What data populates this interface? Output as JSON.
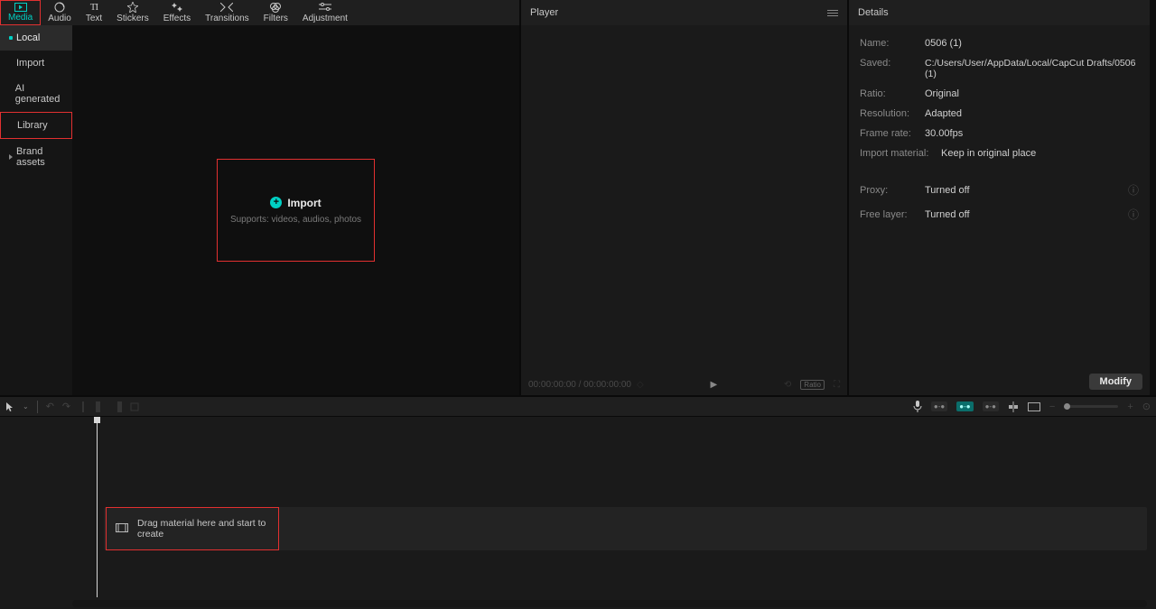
{
  "topTabs": [
    {
      "label": "Media",
      "icon": "media"
    },
    {
      "label": "Audio",
      "icon": "audio"
    },
    {
      "label": "Text",
      "icon": "text"
    },
    {
      "label": "Stickers",
      "icon": "stickers"
    },
    {
      "label": "Effects",
      "icon": "effects"
    },
    {
      "label": "Transitions",
      "icon": "transitions"
    },
    {
      "label": "Filters",
      "icon": "filters"
    },
    {
      "label": "Adjustment",
      "icon": "adjustment"
    }
  ],
  "sidebar": {
    "local": "Local",
    "import": "Import",
    "ai": "AI generated",
    "library": "Library",
    "brand": "Brand assets"
  },
  "importArea": {
    "label": "Import",
    "sub": "Supports: videos, audios, photos"
  },
  "player": {
    "title": "Player",
    "time": "00:00:00:00 / 00:00:00:00",
    "ratioLabel": "Ratio"
  },
  "details": {
    "title": "Details",
    "rows": {
      "nameK": "Name:",
      "nameV": "0506 (1)",
      "savedK": "Saved:",
      "savedV": "C:/Users/User/AppData/Local/CapCut Drafts/0506 (1)",
      "ratioK": "Ratio:",
      "ratioV": "Original",
      "resK": "Resolution:",
      "resV": "Adapted",
      "frK": "Frame rate:",
      "frV": "30.00fps",
      "impK": "Import material:",
      "impV": "Keep in original place",
      "proxyK": "Proxy:",
      "proxyV": "Turned off",
      "freeK": "Free layer:",
      "freeV": "Turned off"
    },
    "modify": "Modify"
  },
  "timeline": {
    "dropText": "Drag material here and start to create"
  }
}
